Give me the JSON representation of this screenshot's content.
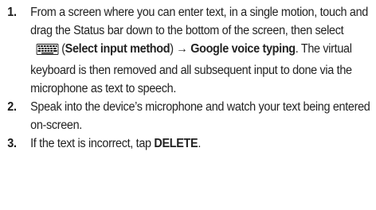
{
  "steps": [
    {
      "number": "1.",
      "text_a": "From a screen where you can enter text, in a single motion, touch and drag the Status bar down to the bottom of the screen, then select",
      "icon": "keyboard-icon",
      "text_b": "(",
      "bold_a": "Select input method",
      "text_c": ") ",
      "arrow": "→",
      "bold_b": "Google voice typing",
      "text_d": ". The virtual keyboard is then removed and all subsequent input to done via the microphone as text to speech."
    },
    {
      "number": "2.",
      "text": "Speak into the device’s microphone and watch your text being entered on-screen."
    },
    {
      "number": "3.",
      "text_a": "If the text is incorrect, tap ",
      "bold": "DELETE",
      "text_b": "."
    }
  ]
}
